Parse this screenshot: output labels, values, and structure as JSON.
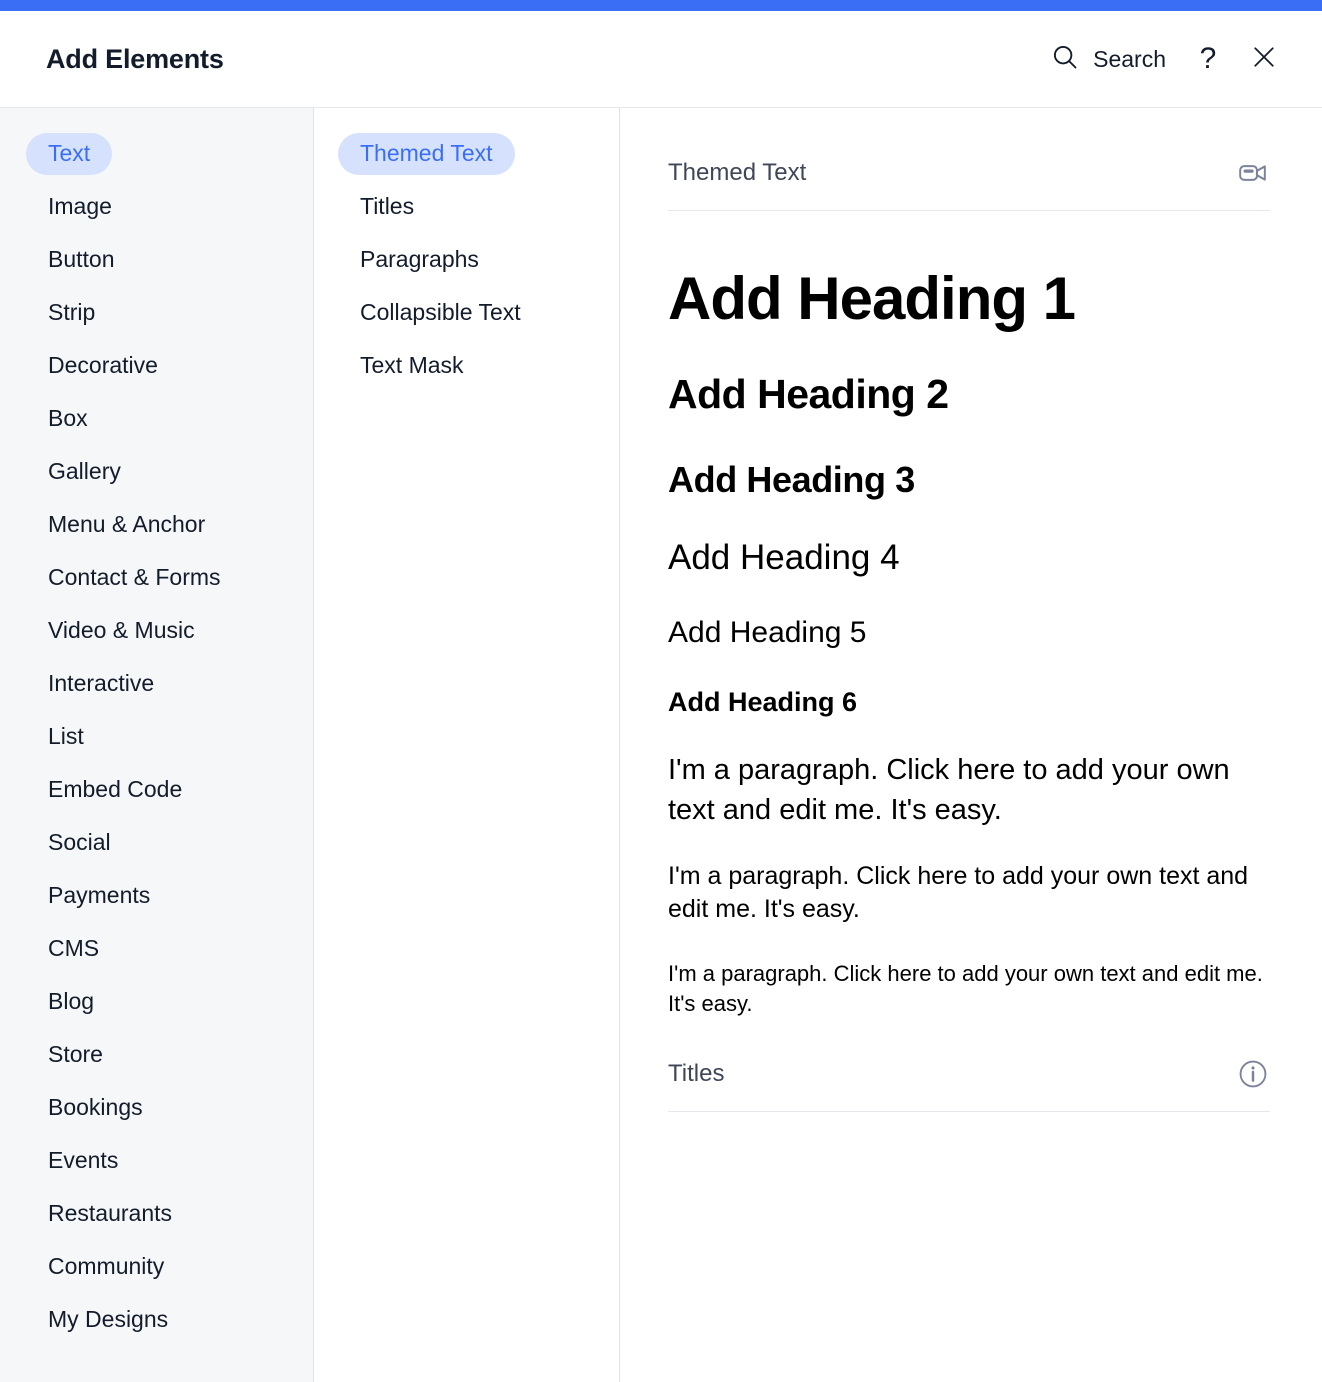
{
  "accent_color": "#3a6ef5",
  "pill_bg_color": "#d6e1fd",
  "header": {
    "title": "Add Elements",
    "search_label": "Search",
    "help_glyph": "?",
    "search_icon": "search-icon",
    "help_icon": "question-mark-icon",
    "close_icon": "close-icon"
  },
  "sidebar": {
    "items": [
      {
        "label": "Text",
        "selected": true
      },
      {
        "label": "Image",
        "selected": false
      },
      {
        "label": "Button",
        "selected": false
      },
      {
        "label": "Strip",
        "selected": false
      },
      {
        "label": "Decorative",
        "selected": false
      },
      {
        "label": "Box",
        "selected": false
      },
      {
        "label": "Gallery",
        "selected": false
      },
      {
        "label": "Menu & Anchor",
        "selected": false
      },
      {
        "label": "Contact & Forms",
        "selected": false
      },
      {
        "label": "Video & Music",
        "selected": false
      },
      {
        "label": "Interactive",
        "selected": false
      },
      {
        "label": "List",
        "selected": false
      },
      {
        "label": "Embed Code",
        "selected": false
      },
      {
        "label": "Social",
        "selected": false
      },
      {
        "label": "Payments",
        "selected": false
      },
      {
        "label": "CMS",
        "selected": false
      },
      {
        "label": "Blog",
        "selected": false
      },
      {
        "label": "Store",
        "selected": false
      },
      {
        "label": "Bookings",
        "selected": false
      },
      {
        "label": "Events",
        "selected": false
      },
      {
        "label": "Restaurants",
        "selected": false
      },
      {
        "label": "Community",
        "selected": false
      },
      {
        "label": "My Designs",
        "selected": false
      }
    ]
  },
  "subnav": {
    "items": [
      {
        "label": "Themed Text",
        "selected": true
      },
      {
        "label": "Titles",
        "selected": false
      },
      {
        "label": "Paragraphs",
        "selected": false
      },
      {
        "label": "Collapsible Text",
        "selected": false
      },
      {
        "label": "Text Mask",
        "selected": false
      }
    ]
  },
  "preview": {
    "sections": [
      {
        "title": "Themed Text",
        "icon": "video-camera-minus-icon",
        "items": [
          {
            "style": "h1",
            "text": "Add Heading 1"
          },
          {
            "style": "h2",
            "text": "Add Heading 2"
          },
          {
            "style": "h3",
            "text": "Add Heading 3"
          },
          {
            "style": "h4",
            "text": "Add Heading 4"
          },
          {
            "style": "h5",
            "text": "Add Heading 5"
          },
          {
            "style": "h6",
            "text": "Add Heading 6"
          },
          {
            "style": "p1",
            "text": "I'm a paragraph. Click here to add your own text and edit me. It's easy."
          },
          {
            "style": "p2",
            "text": "I'm a paragraph. Click here to add your own text and edit me. It's easy."
          },
          {
            "style": "p3",
            "text": "I'm a paragraph. Click here to add your own text and edit me. It's easy."
          }
        ]
      },
      {
        "title": "Titles",
        "icon": "info-icon",
        "items": []
      }
    ]
  }
}
